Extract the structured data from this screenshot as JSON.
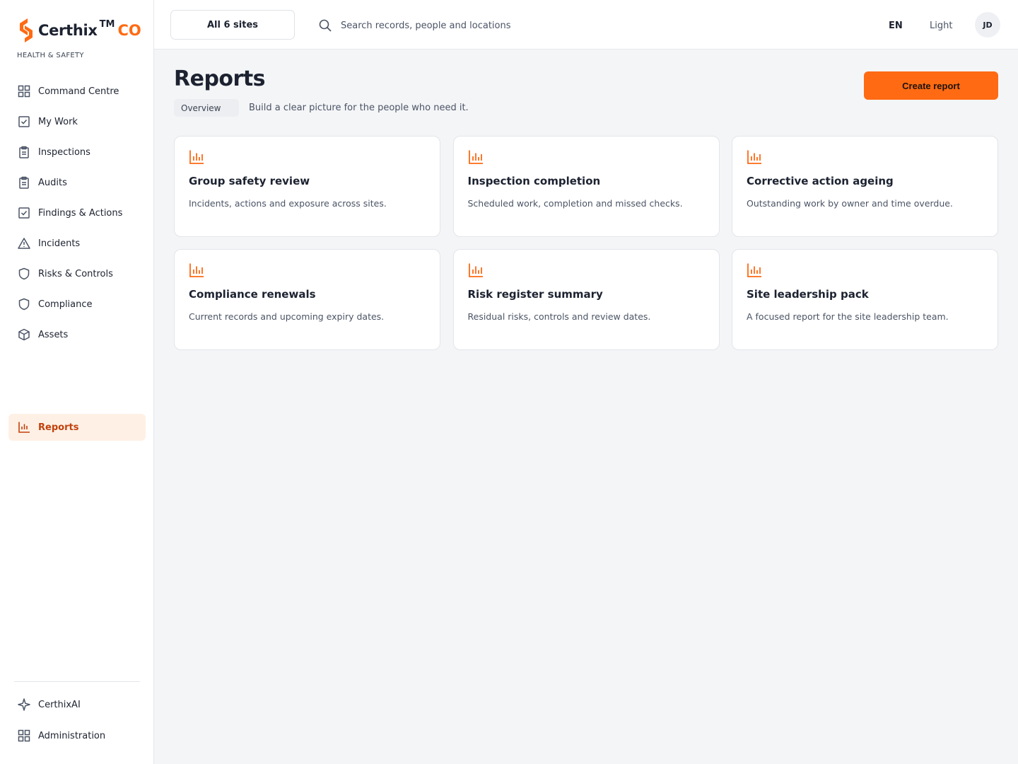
{
  "brand": {
    "name": "Certhix",
    "tm": "TM",
    "suffix": "CO",
    "subtitle": "HEALTH & SAFETY",
    "accent": "#ff6a13"
  },
  "sidebar": {
    "items": [
      {
        "label": "Command Centre",
        "icon": "grid-icon"
      },
      {
        "label": "My Work",
        "icon": "checkbox-icon"
      },
      {
        "label": "Inspections",
        "icon": "clipboard-icon"
      },
      {
        "label": "Audits",
        "icon": "clipboard-icon"
      },
      {
        "label": "Findings & Actions",
        "icon": "checkbox-icon"
      },
      {
        "label": "Incidents",
        "icon": "warning-icon"
      },
      {
        "label": "Risks & Controls",
        "icon": "shield-icon"
      },
      {
        "label": "Compliance",
        "icon": "shield-icon"
      },
      {
        "label": "Assets",
        "icon": "box-icon"
      }
    ],
    "reports": {
      "label": "Reports",
      "icon": "bar-chart-icon",
      "active": true
    },
    "bottom": [
      {
        "label": "CerthixAI",
        "icon": "sparkle-icon"
      },
      {
        "label": "Administration",
        "icon": "grid-icon"
      }
    ]
  },
  "topbar": {
    "site_selector": "All 6 sites",
    "search_placeholder": "Search records, people and locations",
    "language": "EN",
    "theme": "Light",
    "avatar_initials": "JD"
  },
  "page": {
    "title": "Reports",
    "tab": "Overview",
    "subtitle": "Build a clear picture for the people who need it.",
    "create_button": "Create report"
  },
  "reports": [
    {
      "title": "Group safety review",
      "description": "Incidents, actions and exposure across sites."
    },
    {
      "title": "Inspection completion",
      "description": "Scheduled work, completion and missed checks."
    },
    {
      "title": "Corrective action ageing",
      "description": "Outstanding work by owner and time overdue."
    },
    {
      "title": "Compliance renewals",
      "description": "Current records and upcoming expiry dates."
    },
    {
      "title": "Risk register summary",
      "description": "Residual risks, controls and review dates."
    },
    {
      "title": "Site leadership pack",
      "description": "A focused report for the site leadership team."
    }
  ]
}
